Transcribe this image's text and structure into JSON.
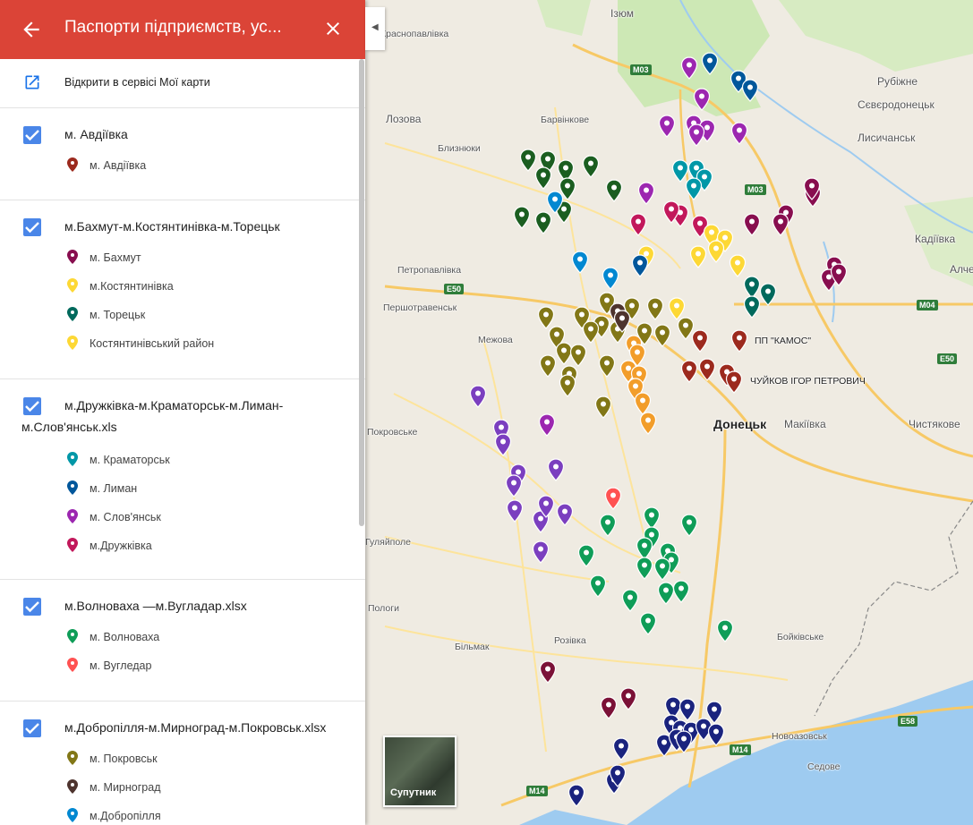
{
  "panel": {
    "title": "Паспорти підприємств, ус...",
    "open_in_my_maps": "Відкрити в сервісі Мої карти",
    "groups": [
      {
        "title": "м. Авдіївка",
        "layers": [
          {
            "label": "м. Авдіївка",
            "color": "#9c2a1e"
          }
        ]
      },
      {
        "title": "м.Бахмут-м.Костянтинівка-м.Торецьк",
        "layers": [
          {
            "label": "м. Бахмут",
            "color": "#880e4f"
          },
          {
            "label": "м.Костянтинівка",
            "color": "#fdd835"
          },
          {
            "label": "м. Торецьк",
            "color": "#00695c"
          },
          {
            "label": "Костянтинівський район",
            "color": "#fdd835"
          }
        ]
      },
      {
        "title": "м.Дружківка-м.Краматорськ-м.Лиман-м.Слов'янськ.xls",
        "layers": [
          {
            "label": "м. Краматорськ",
            "color": "#0097a7"
          },
          {
            "label": "м. Лиман",
            "color": "#01579b"
          },
          {
            "label": "м. Слов'янськ",
            "color": "#9c27b0"
          },
          {
            "label": "м.Дружківка",
            "color": "#c2185b"
          }
        ]
      },
      {
        "title": "м.Волноваха —м.Вугладар.xlsx",
        "layers": [
          {
            "label": "м. Волноваха",
            "color": "#0f9d58"
          },
          {
            "label": "м. Вугледар",
            "color": "#ff5252"
          }
        ]
      },
      {
        "title": "м.Добропілля-м.Мирноград-м.Покровськ.xlsx",
        "layers": [
          {
            "label": "м. Покровськ",
            "color": "#827717"
          },
          {
            "label": "м. Мирноград",
            "color": "#4e342e"
          },
          {
            "label": "м.Добропілля",
            "color": "#0288d1"
          }
        ]
      }
    ]
  },
  "map": {
    "places": [
      "Ізюм",
      "Краснопавлівка",
      "Рубіжне",
      "Лозова",
      "Барвінкове",
      "Сєвєродонецьк",
      "Лисичанськ",
      "Близнюки",
      "Кадіївка",
      "Алче",
      "Петропавлівка",
      "Першотравенськ",
      "Межова",
      "Донецьк",
      "Макіївка",
      "Чистякове",
      "Покровське",
      "Гуляйполе",
      "Пологи",
      "Більмак",
      "Розівка",
      "Бойківське",
      "Новоазовськ",
      "Седове"
    ],
    "shields": [
      "M03",
      "M03",
      "E50",
      "M04",
      "E50",
      "M14",
      "M14",
      "E58"
    ],
    "pois": [
      "ПП \"КАМОС\"",
      "ЧУЙКОВ ІГОР ПЕТРОВИЧ"
    ],
    "satellite_label": "Супутник"
  }
}
